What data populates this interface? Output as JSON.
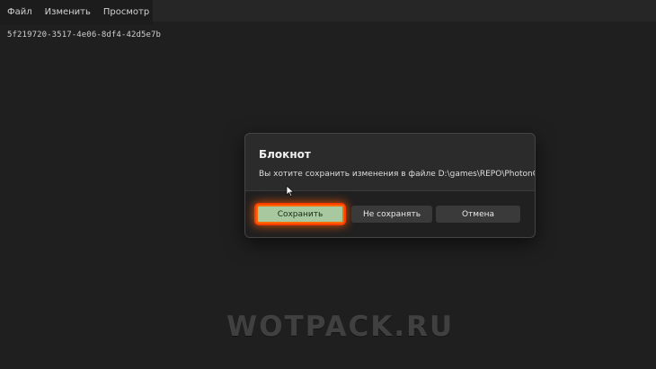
{
  "menubar": {
    "items": [
      {
        "label": "Файл"
      },
      {
        "label": "Изменить"
      },
      {
        "label": "Просмотр"
      }
    ]
  },
  "editor": {
    "content": "5f219720-3517-4e06-8df4-42d5e7b"
  },
  "dialog": {
    "title": "Блокнот",
    "message": "Вы хотите сохранить изменения в файле D:\\games\\REPO\\PhotonConfig.ini?",
    "buttons": {
      "save": "Сохранить",
      "dont_save": "Не сохранять",
      "cancel": "Отмена"
    },
    "highlight_color": "#ff5a00"
  },
  "watermark": {
    "text": "WOTPACK.RU"
  },
  "icons": {
    "cursor": "mouse-pointer-icon"
  }
}
